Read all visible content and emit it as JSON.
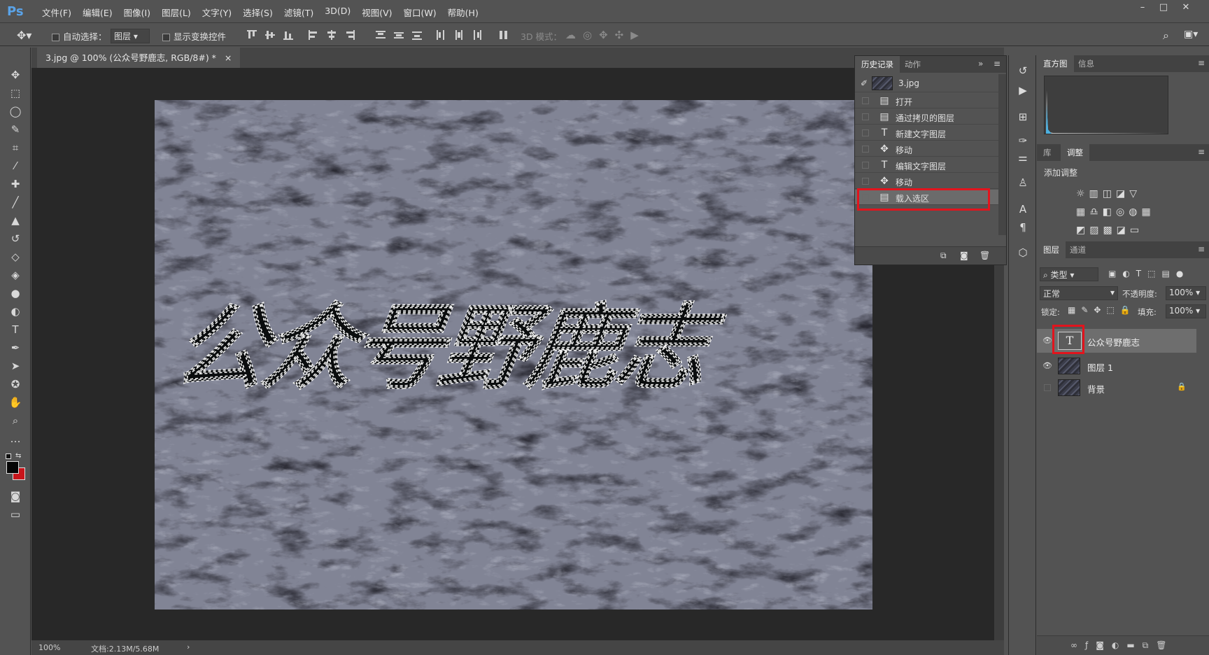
{
  "app": {
    "logo": "Ps"
  },
  "menu": [
    "文件(F)",
    "编辑(E)",
    "图像(I)",
    "图层(L)",
    "文字(Y)",
    "选择(S)",
    "滤镜(T)",
    "3D(D)",
    "视图(V)",
    "窗口(W)",
    "帮助(H)"
  ],
  "options": {
    "auto_select_label": "自动选择：",
    "auto_select_value": "图层",
    "show_transform_label": "显示变换控件",
    "mode_3d_label": "3D 模式："
  },
  "document": {
    "tab_title": "3.jpg @ 100% (公众号野鹿志, RGB/8#) *",
    "canvas_text": "公众号野鹿志",
    "zoom": "100%",
    "doc_info": "文档:2.13M/5.68M"
  },
  "history_panel": {
    "tabs": [
      "历史记录",
      "动作"
    ],
    "snapshot": "3.jpg",
    "items": [
      {
        "icon": "doc",
        "label": "打开"
      },
      {
        "icon": "doc",
        "label": "通过拷贝的图层"
      },
      {
        "icon": "T",
        "label": "新建文字图层"
      },
      {
        "icon": "move",
        "label": "移动"
      },
      {
        "icon": "T",
        "label": "编辑文字图层"
      },
      {
        "icon": "move",
        "label": "移动"
      },
      {
        "icon": "doc",
        "label": "载入选区"
      }
    ],
    "active_index": 6
  },
  "histogram_panel": {
    "tabs": [
      "直方图",
      "信息"
    ]
  },
  "adjust_panel": {
    "tabs": [
      "库",
      "调整"
    ],
    "title": "添加调整"
  },
  "layers_panel": {
    "tabs": [
      "图层",
      "通道"
    ],
    "filter_kind": "类型",
    "blend_mode": "正常",
    "opacity_label": "不透明度:",
    "opacity_value": "100%",
    "lock_label": "锁定:",
    "fill_label": "填充:",
    "fill_value": "100%",
    "layers": [
      {
        "name": "公众号野鹿志",
        "type": "text",
        "visible": true,
        "selected": true
      },
      {
        "name": "图层 1",
        "type": "image",
        "visible": true,
        "selected": false
      },
      {
        "name": "背景",
        "type": "image",
        "visible": false,
        "selected": false,
        "locked": true
      }
    ]
  },
  "colors": {
    "highlight_red": "#e2141d",
    "ps_blue": "#5aa3e8",
    "panel_bg": "#535353"
  }
}
